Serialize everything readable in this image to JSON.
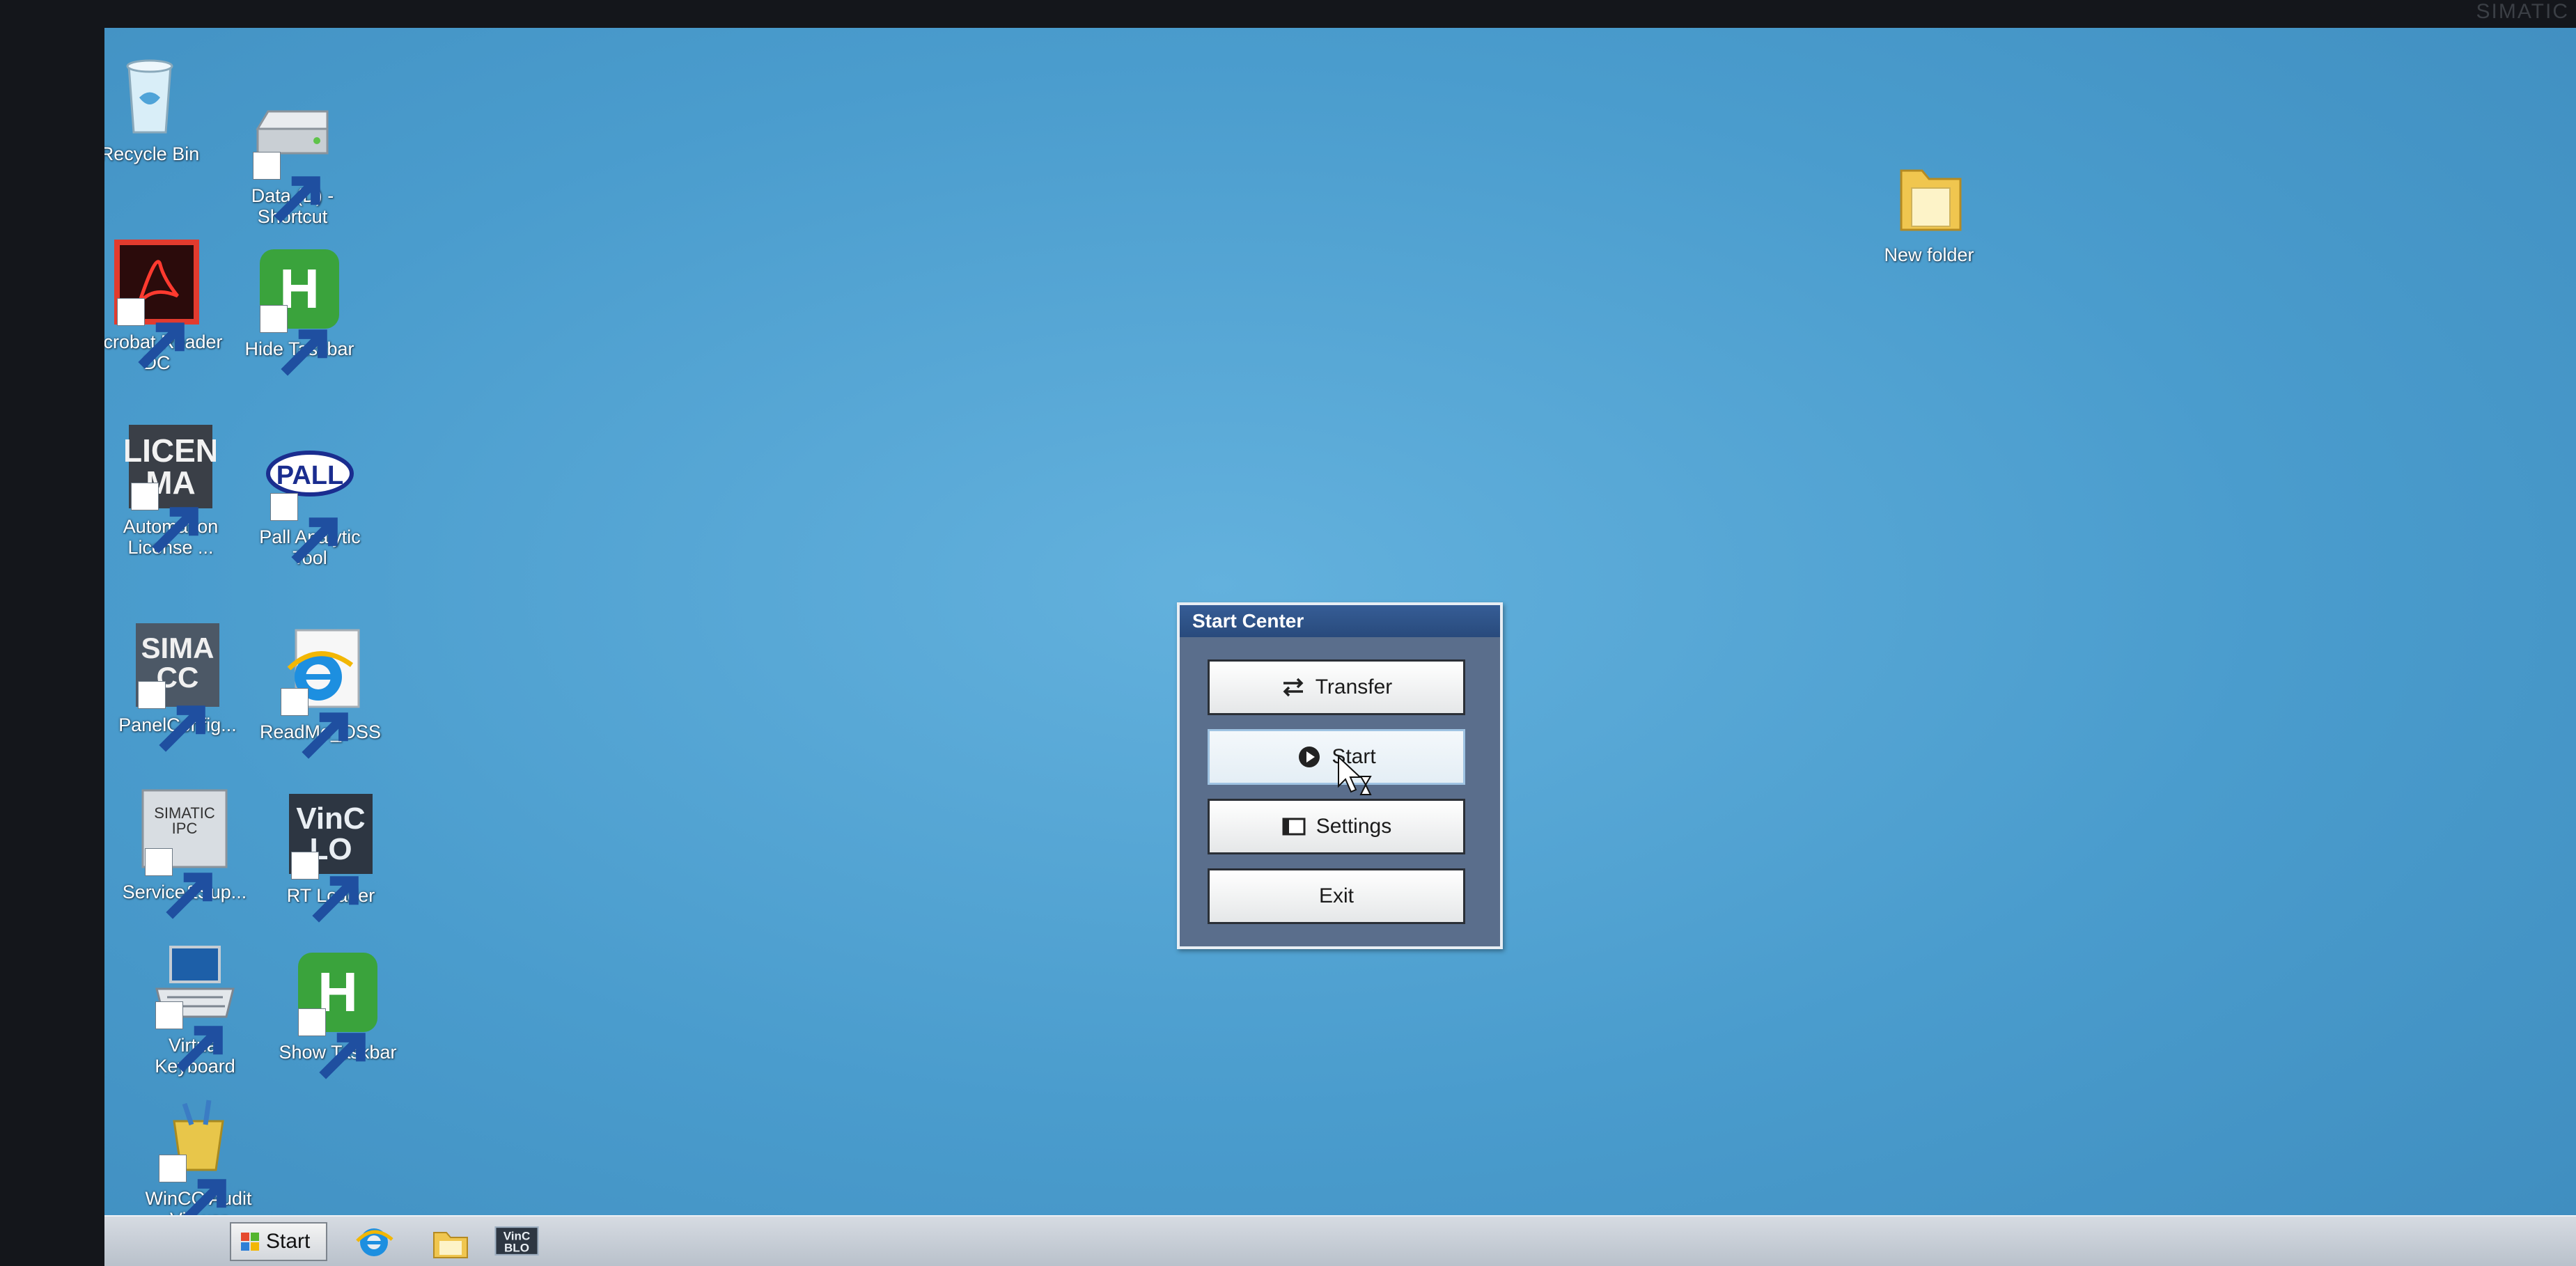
{
  "desktop": {
    "icons": [
      {
        "id": "recycle-bin",
        "label": "Recycle Bin"
      },
      {
        "id": "data-d-shortcut",
        "label": "Data (D) -\nShortcut"
      },
      {
        "id": "acrobat-reader",
        "label": "Acrobat Reader\nDC"
      },
      {
        "id": "hide-taskbar",
        "label": "Hide Taskbar"
      },
      {
        "id": "automation-license",
        "label": "Automation\nLicense ..."
      },
      {
        "id": "pall-analytic",
        "label": "Pall Analytic\nTool"
      },
      {
        "id": "panelconfig",
        "label": "PanelConfig..."
      },
      {
        "id": "readme-oss",
        "label": "ReadMe_OSS"
      },
      {
        "id": "service-support",
        "label": "Service&Sup..."
      },
      {
        "id": "rt-loader",
        "label": "RT Loader"
      },
      {
        "id": "virtual-keyboard",
        "label": "Virtual\nKeyboard"
      },
      {
        "id": "show-taskbar",
        "label": "Show Taskbar"
      },
      {
        "id": "wincc-audit",
        "label": "WinCC Audit\nViewer"
      },
      {
        "id": "new-folder",
        "label": "New folder"
      }
    ],
    "icon_texts": {
      "license": "LICEN\nMA",
      "pall": "PALL",
      "simatic_wincc": "SIMA\nCC",
      "simatic_ipc": "SIMATIC\nIPC",
      "wincc_rt": "VinC\nLO",
      "hide_show": "H"
    }
  },
  "dialog": {
    "title": "Start Center",
    "buttons": [
      {
        "label": "Transfer",
        "icon": "transfer-arrows-icon"
      },
      {
        "label": "Start",
        "icon": "play-icon"
      },
      {
        "label": "Settings",
        "icon": "settings-window-icon"
      },
      {
        "label": "Exit",
        "icon": ""
      }
    ]
  },
  "taskbar": {
    "start_label": "Start",
    "pinned": [
      "internet-explorer-icon",
      "file-explorer-icon",
      "wincc-runtime-icon"
    ],
    "pinned_texts": {
      "wincc": "VinC\nBLO"
    }
  },
  "monitor": {
    "brand_text": "SIMATIC"
  },
  "colors": {
    "desktop": "#4a9ccd",
    "dialog_bg": "#5a6e8c",
    "titlebar": "#2f5489",
    "taskbar": "#c7cdd5"
  }
}
